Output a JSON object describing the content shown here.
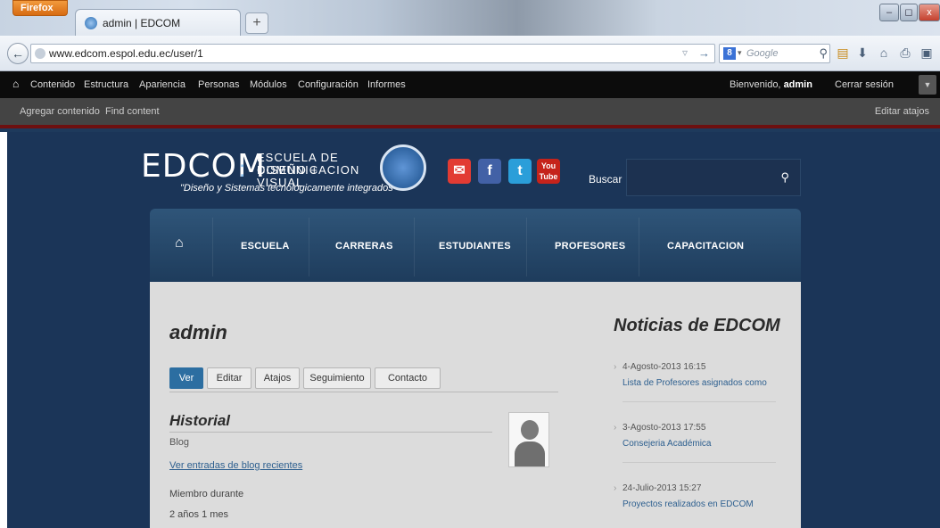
{
  "browser": {
    "app_button": "Firefox",
    "tab_title": "admin | EDCOM",
    "new_tab": "+",
    "url": "www.edcom.espol.edu.ec/user/1",
    "search_placeholder": "Google",
    "search_engine_icon": "8",
    "window_buttons": {
      "minimize": "–",
      "maximize": "◻",
      "close": "x"
    },
    "icons": [
      "bookmark-star-icon",
      "go-arrow-icon",
      "search-icon",
      "download-icon",
      "home-icon",
      "print-icon",
      "addon-icon"
    ]
  },
  "admin_toolbar": {
    "home_icon": "home-icon",
    "menu": [
      "Contenido",
      "Estructura",
      "Apariencia",
      "Personas",
      "Módulos",
      "Configuración",
      "Informes"
    ],
    "welcome_prefix": "Bienvenido,",
    "welcome_user": "admin",
    "logout": "Cerrar sesión",
    "shortcuts": {
      "add": "Agregar contenido",
      "find": "Find content",
      "edit": "Editar atajos"
    }
  },
  "site": {
    "logo": {
      "brand": "EDCOM",
      "line1": "ESCUELA DE DISEÑO +",
      "line2": "COMUNICACION VISUAL",
      "slogan": "\"Diseño y Sistemas tecnológicamente integrados\""
    },
    "social": {
      "mail": "✉",
      "facebook": "f",
      "twitter": "t",
      "youtube": "You Tube"
    },
    "search_label": "Buscar",
    "nav": [
      "ESCUELA",
      "CARRERAS",
      "ESTUDIANTES",
      "PROFESORES",
      "CAPACITACION"
    ]
  },
  "profile": {
    "title": "admin",
    "tabs": [
      "Ver",
      "Editar",
      "Atajos",
      "Seguimiento",
      "Contacto"
    ],
    "active_tab": "Ver",
    "history_title": "Historial",
    "blog_label": "Blog",
    "blog_link": "Ver entradas de blog recientes",
    "member_label": "Miembro durante",
    "member_value": "2 años 1 mes"
  },
  "news": {
    "title": "Noticias de EDCOM",
    "items": [
      {
        "date": "4-Agosto-2013 16:15",
        "title": "Lista de Profesores asignados como"
      },
      {
        "date": "3-Agosto-2013 17:55",
        "title": "Consejeria Académica"
      },
      {
        "date": "24-Julio-2013 15:27",
        "title": "Proyectos realizados en EDCOM"
      }
    ]
  },
  "colors": {
    "page_bg": "#1b3558",
    "admin_bar": "#0c0c0c",
    "accent_red": "#6d1010",
    "active_tab": "#2c6ea1",
    "link": "#2d5f8f"
  }
}
